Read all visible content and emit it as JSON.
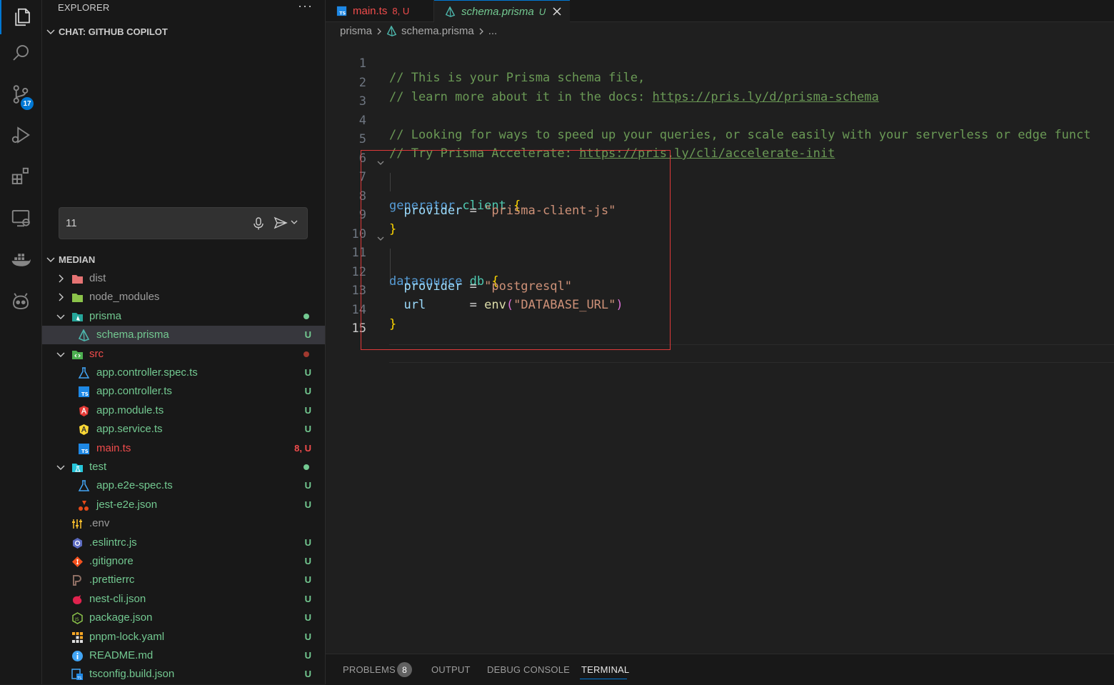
{
  "activity_bar": {
    "items": [
      "explorer-icon",
      "search-icon",
      "source-control-icon",
      "run-debug-icon",
      "extensions-icon",
      "remote-explorer-icon",
      "docker-icon",
      "copilot-icon"
    ],
    "source_control_badge": "17"
  },
  "sidebar": {
    "title": "EXPLORER",
    "more": "···",
    "chat_section": "CHAT: GITHUB COPILOT",
    "chat_input_value": "11",
    "workspace_section": "MEDIAN",
    "tree": [
      {
        "label": "dist",
        "status": ""
      },
      {
        "label": "node_modules",
        "status": ""
      },
      {
        "label": "prisma",
        "status": ""
      },
      {
        "label": "schema.prisma",
        "status": "U"
      },
      {
        "label": "src",
        "status": ""
      },
      {
        "label": "app.controller.spec.ts",
        "status": "U"
      },
      {
        "label": "app.controller.ts",
        "status": "U"
      },
      {
        "label": "app.module.ts",
        "status": "U"
      },
      {
        "label": "app.service.ts",
        "status": "U"
      },
      {
        "label": "main.ts",
        "status": "8, U"
      },
      {
        "label": "test",
        "status": ""
      },
      {
        "label": "app.e2e-spec.ts",
        "status": "U"
      },
      {
        "label": "jest-e2e.json",
        "status": "U"
      },
      {
        "label": ".env",
        "status": ""
      },
      {
        "label": ".eslintrc.js",
        "status": "U"
      },
      {
        "label": ".gitignore",
        "status": "U"
      },
      {
        "label": ".prettierrc",
        "status": "U"
      },
      {
        "label": "nest-cli.json",
        "status": "U"
      },
      {
        "label": "package.json",
        "status": "U"
      },
      {
        "label": "pnpm-lock.yaml",
        "status": "U"
      },
      {
        "label": "README.md",
        "status": "U"
      },
      {
        "label": "tsconfig.build.json",
        "status": "U"
      }
    ]
  },
  "tabs": [
    {
      "label": "main.ts",
      "status": "8, U"
    },
    {
      "label": "schema.prisma",
      "status": "U"
    }
  ],
  "breadcrumb": {
    "folder": "prisma",
    "file": "schema.prisma",
    "more": "..."
  },
  "editor": {
    "line_numbers": [
      "1",
      "2",
      "3",
      "4",
      "5",
      "6",
      "7",
      "8",
      "9",
      "10",
      "11",
      "12",
      "13",
      "14",
      "15"
    ],
    "l1": "// This is your Prisma schema file,",
    "l2_text": "// learn more about it in the docs: ",
    "l2_link": "https://pris.ly/d/prisma-schema",
    "l4": "// Looking for ways to speed up your queries, or scale easily with your serverless or edge funct",
    "l5_text": "// Try Prisma Accelerate: ",
    "l5_link": "https://pris.ly/cli/accelerate-init",
    "kw_generator": "generator",
    "id_client": "client",
    "prop_provider": "provider",
    "str_client_js": "\"prisma-client-js\"",
    "kw_datasource": "datasource",
    "id_db": "db",
    "str_postgresql": "\"postgresql\"",
    "prop_url": "url",
    "fn_env": "env",
    "str_db_url": "\"DATABASE_URL\"",
    "open_brace": "{",
    "close_brace": "}",
    "eq": "=",
    "open_paren": "(",
    "close_paren": ")"
  },
  "panel": {
    "tabs": [
      "PROBLEMS",
      "OUTPUT",
      "DEBUG CONSOLE",
      "TERMINAL"
    ],
    "problems_count": "8",
    "active_tab": "TERMINAL"
  },
  "colors": {
    "accent": "#0078d4",
    "highlight_box": "#e03a3a",
    "untracked": "#73c991",
    "error": "#f14c4c"
  }
}
